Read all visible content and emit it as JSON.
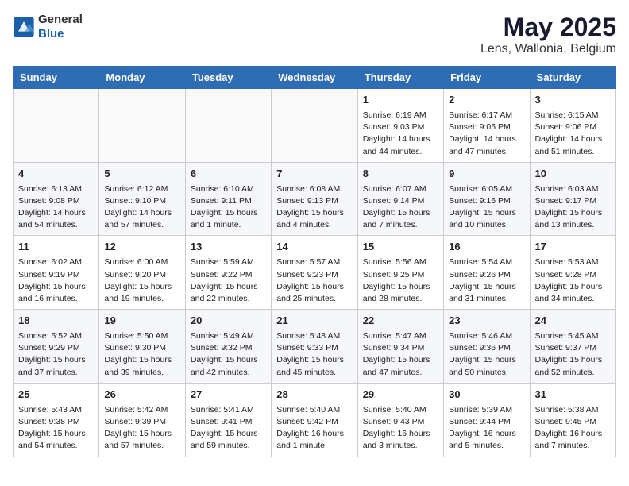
{
  "header": {
    "logo_general": "General",
    "logo_blue": "Blue",
    "title": "May 2025",
    "subtitle": "Lens, Wallonia, Belgium"
  },
  "weekdays": [
    "Sunday",
    "Monday",
    "Tuesday",
    "Wednesday",
    "Thursday",
    "Friday",
    "Saturday"
  ],
  "weeks": [
    [
      {
        "day": "",
        "info": ""
      },
      {
        "day": "",
        "info": ""
      },
      {
        "day": "",
        "info": ""
      },
      {
        "day": "",
        "info": ""
      },
      {
        "day": "1",
        "info": "Sunrise: 6:19 AM\nSunset: 9:03 PM\nDaylight: 14 hours\nand 44 minutes."
      },
      {
        "day": "2",
        "info": "Sunrise: 6:17 AM\nSunset: 9:05 PM\nDaylight: 14 hours\nand 47 minutes."
      },
      {
        "day": "3",
        "info": "Sunrise: 6:15 AM\nSunset: 9:06 PM\nDaylight: 14 hours\nand 51 minutes."
      }
    ],
    [
      {
        "day": "4",
        "info": "Sunrise: 6:13 AM\nSunset: 9:08 PM\nDaylight: 14 hours\nand 54 minutes."
      },
      {
        "day": "5",
        "info": "Sunrise: 6:12 AM\nSunset: 9:10 PM\nDaylight: 14 hours\nand 57 minutes."
      },
      {
        "day": "6",
        "info": "Sunrise: 6:10 AM\nSunset: 9:11 PM\nDaylight: 15 hours\nand 1 minute."
      },
      {
        "day": "7",
        "info": "Sunrise: 6:08 AM\nSunset: 9:13 PM\nDaylight: 15 hours\nand 4 minutes."
      },
      {
        "day": "8",
        "info": "Sunrise: 6:07 AM\nSunset: 9:14 PM\nDaylight: 15 hours\nand 7 minutes."
      },
      {
        "day": "9",
        "info": "Sunrise: 6:05 AM\nSunset: 9:16 PM\nDaylight: 15 hours\nand 10 minutes."
      },
      {
        "day": "10",
        "info": "Sunrise: 6:03 AM\nSunset: 9:17 PM\nDaylight: 15 hours\nand 13 minutes."
      }
    ],
    [
      {
        "day": "11",
        "info": "Sunrise: 6:02 AM\nSunset: 9:19 PM\nDaylight: 15 hours\nand 16 minutes."
      },
      {
        "day": "12",
        "info": "Sunrise: 6:00 AM\nSunset: 9:20 PM\nDaylight: 15 hours\nand 19 minutes."
      },
      {
        "day": "13",
        "info": "Sunrise: 5:59 AM\nSunset: 9:22 PM\nDaylight: 15 hours\nand 22 minutes."
      },
      {
        "day": "14",
        "info": "Sunrise: 5:57 AM\nSunset: 9:23 PM\nDaylight: 15 hours\nand 25 minutes."
      },
      {
        "day": "15",
        "info": "Sunrise: 5:56 AM\nSunset: 9:25 PM\nDaylight: 15 hours\nand 28 minutes."
      },
      {
        "day": "16",
        "info": "Sunrise: 5:54 AM\nSunset: 9:26 PM\nDaylight: 15 hours\nand 31 minutes."
      },
      {
        "day": "17",
        "info": "Sunrise: 5:53 AM\nSunset: 9:28 PM\nDaylight: 15 hours\nand 34 minutes."
      }
    ],
    [
      {
        "day": "18",
        "info": "Sunrise: 5:52 AM\nSunset: 9:29 PM\nDaylight: 15 hours\nand 37 minutes."
      },
      {
        "day": "19",
        "info": "Sunrise: 5:50 AM\nSunset: 9:30 PM\nDaylight: 15 hours\nand 39 minutes."
      },
      {
        "day": "20",
        "info": "Sunrise: 5:49 AM\nSunset: 9:32 PM\nDaylight: 15 hours\nand 42 minutes."
      },
      {
        "day": "21",
        "info": "Sunrise: 5:48 AM\nSunset: 9:33 PM\nDaylight: 15 hours\nand 45 minutes."
      },
      {
        "day": "22",
        "info": "Sunrise: 5:47 AM\nSunset: 9:34 PM\nDaylight: 15 hours\nand 47 minutes."
      },
      {
        "day": "23",
        "info": "Sunrise: 5:46 AM\nSunset: 9:36 PM\nDaylight: 15 hours\nand 50 minutes."
      },
      {
        "day": "24",
        "info": "Sunrise: 5:45 AM\nSunset: 9:37 PM\nDaylight: 15 hours\nand 52 minutes."
      }
    ],
    [
      {
        "day": "25",
        "info": "Sunrise: 5:43 AM\nSunset: 9:38 PM\nDaylight: 15 hours\nand 54 minutes."
      },
      {
        "day": "26",
        "info": "Sunrise: 5:42 AM\nSunset: 9:39 PM\nDaylight: 15 hours\nand 57 minutes."
      },
      {
        "day": "27",
        "info": "Sunrise: 5:41 AM\nSunset: 9:41 PM\nDaylight: 15 hours\nand 59 minutes."
      },
      {
        "day": "28",
        "info": "Sunrise: 5:40 AM\nSunset: 9:42 PM\nDaylight: 16 hours\nand 1 minute."
      },
      {
        "day": "29",
        "info": "Sunrise: 5:40 AM\nSunset: 9:43 PM\nDaylight: 16 hours\nand 3 minutes."
      },
      {
        "day": "30",
        "info": "Sunrise: 5:39 AM\nSunset: 9:44 PM\nDaylight: 16 hours\nand 5 minutes."
      },
      {
        "day": "31",
        "info": "Sunrise: 5:38 AM\nSunset: 9:45 PM\nDaylight: 16 hours\nand 7 minutes."
      }
    ]
  ]
}
